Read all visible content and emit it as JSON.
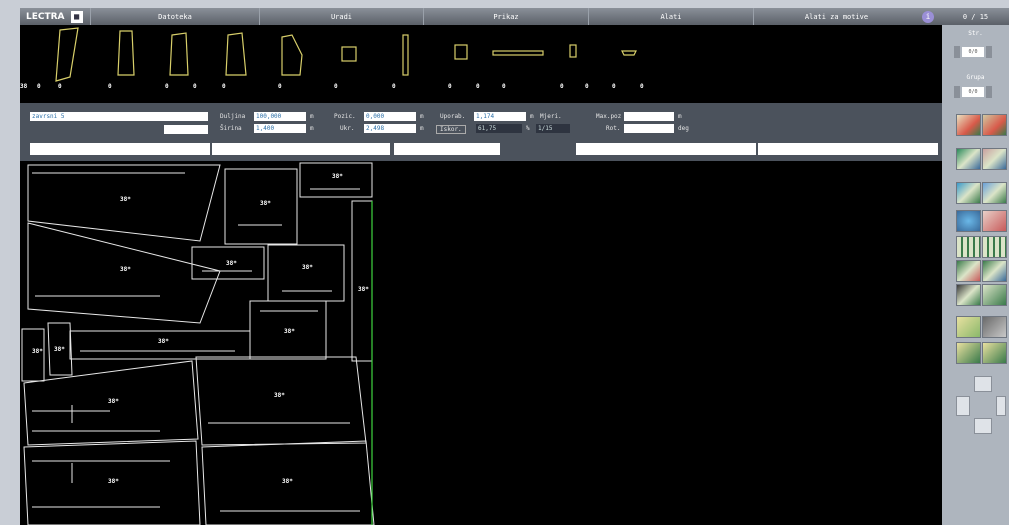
{
  "app": {
    "logo": "LECTRA"
  },
  "menu": [
    {
      "label": "Datoteka"
    },
    {
      "label": "Uradi"
    },
    {
      "label": "Prikaz"
    },
    {
      "label": "Alati"
    },
    {
      "label": "Alati za motive"
    }
  ],
  "info_icon": "info-icon",
  "piece_strip": {
    "first_label": "38",
    "counts": [
      "0",
      "0",
      "0",
      "0",
      "0",
      "0",
      "0",
      "0",
      "0",
      "0",
      "0",
      "0",
      "0",
      "0",
      "0",
      "0"
    ],
    "outline_color": "#d8cf6a"
  },
  "infobar": {
    "name_value": "zavrsni 5",
    "duljina_label": "Duljina",
    "duljina_value": "100,000",
    "sirina_label": "Širina",
    "sirina_value": "1,400",
    "unit_m": "m",
    "pozic_label": "Pozic.",
    "pozic_value": "0,000",
    "ukr_label": "Ukr.",
    "ukr_value": "2,498",
    "uporab_label": "Uporab.",
    "uporab_value": "1,174",
    "mjeri_label": "Mjeri.",
    "iskor_label": "Iskor.",
    "iskor_value": "61,75",
    "percent": "%",
    "ratio_value": "1/15",
    "maxpoz_label": "Max.poz",
    "rot_label": "Rot.",
    "deg_label": "deg"
  },
  "canvas": {
    "piece_labels": [
      "38*",
      "38*",
      "38*",
      "38*",
      "38*",
      "38*",
      "38*",
      "38*",
      "38*",
      "38*",
      "38*",
      "38*",
      "38*",
      "38*",
      "38*"
    ],
    "edge_color": "#3fd43f"
  },
  "right_panel": {
    "counter": "0 / 15",
    "str_label": "Str.",
    "str_value": "0/0",
    "grupa_label": "Grupa",
    "grupa_value": "0/0"
  }
}
